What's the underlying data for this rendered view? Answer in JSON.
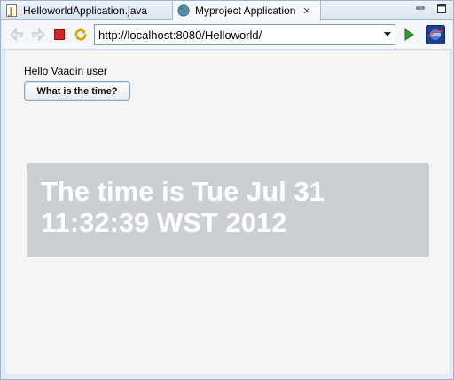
{
  "tabs": [
    {
      "label": "HelloworldApplication.java",
      "icon": "java-file-icon",
      "active": false
    },
    {
      "label": "Myproject Application",
      "icon": "globe-icon",
      "active": true
    }
  ],
  "window_controls": [
    "minimize-icon",
    "maximize-icon"
  ],
  "toolbar": {
    "back": "back-arrow-icon",
    "forward": "forward-arrow-icon",
    "stop": "stop-icon",
    "refresh": "refresh-icon",
    "url": "http://localhost:8080/Helloworld/",
    "go": "go-icon",
    "eclipse": "eclipse-icon"
  },
  "content": {
    "greeting": "Hello Vaadin user",
    "button_label": "What is the time?",
    "time_message": "The time is Tue Jul 31 11:32:39 WST 2012"
  },
  "colors": {
    "panel_bg": "#cbced3",
    "content_bg": "#f5f5f5",
    "stop_red": "#d4251c",
    "go_green": "#2e9e2e"
  }
}
